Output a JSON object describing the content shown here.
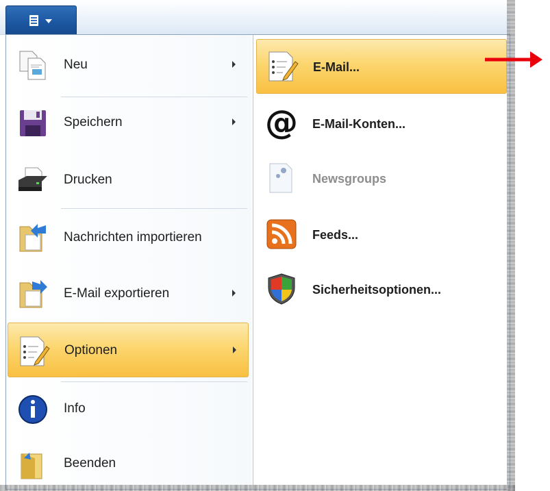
{
  "colors": {
    "accent": "#e8000b",
    "selection": "#f9c042",
    "app_button": "#1d58a3"
  },
  "menu": {
    "items": [
      {
        "label": "Neu",
        "icon": "new-document-icon",
        "submenu": true,
        "selected": false
      },
      {
        "label": "Speichern",
        "icon": "floppy-disk-icon",
        "submenu": true,
        "selected": false
      },
      {
        "label": "Drucken",
        "icon": "printer-icon",
        "submenu": false,
        "selected": false
      },
      {
        "label": "Nachrichten importieren",
        "icon": "import-folder-icon",
        "submenu": false,
        "selected": false
      },
      {
        "label": "E-Mail exportieren",
        "icon": "export-folder-icon",
        "submenu": true,
        "selected": false
      },
      {
        "label": "Optionen",
        "icon": "options-checklist-icon",
        "submenu": true,
        "selected": true
      },
      {
        "label": "Info",
        "icon": "info-icon",
        "submenu": false,
        "selected": false
      },
      {
        "label": "Beenden",
        "icon": "exit-folder-icon",
        "submenu": false,
        "selected": false
      }
    ]
  },
  "submenu": {
    "items": [
      {
        "label": "E-Mail...",
        "icon": "email-checklist-icon",
        "selected": true,
        "disabled": false
      },
      {
        "label": "E-Mail-Konten...",
        "icon": "at-sign-icon",
        "selected": false,
        "disabled": false
      },
      {
        "label": "Newsgroups",
        "icon": "newsgroup-document-icon",
        "selected": false,
        "disabled": true
      },
      {
        "label": "Feeds...",
        "icon": "rss-feed-icon",
        "selected": false,
        "disabled": false
      },
      {
        "label": "Sicherheitsoptionen...",
        "icon": "security-shield-icon",
        "selected": false,
        "disabled": false
      }
    ]
  }
}
